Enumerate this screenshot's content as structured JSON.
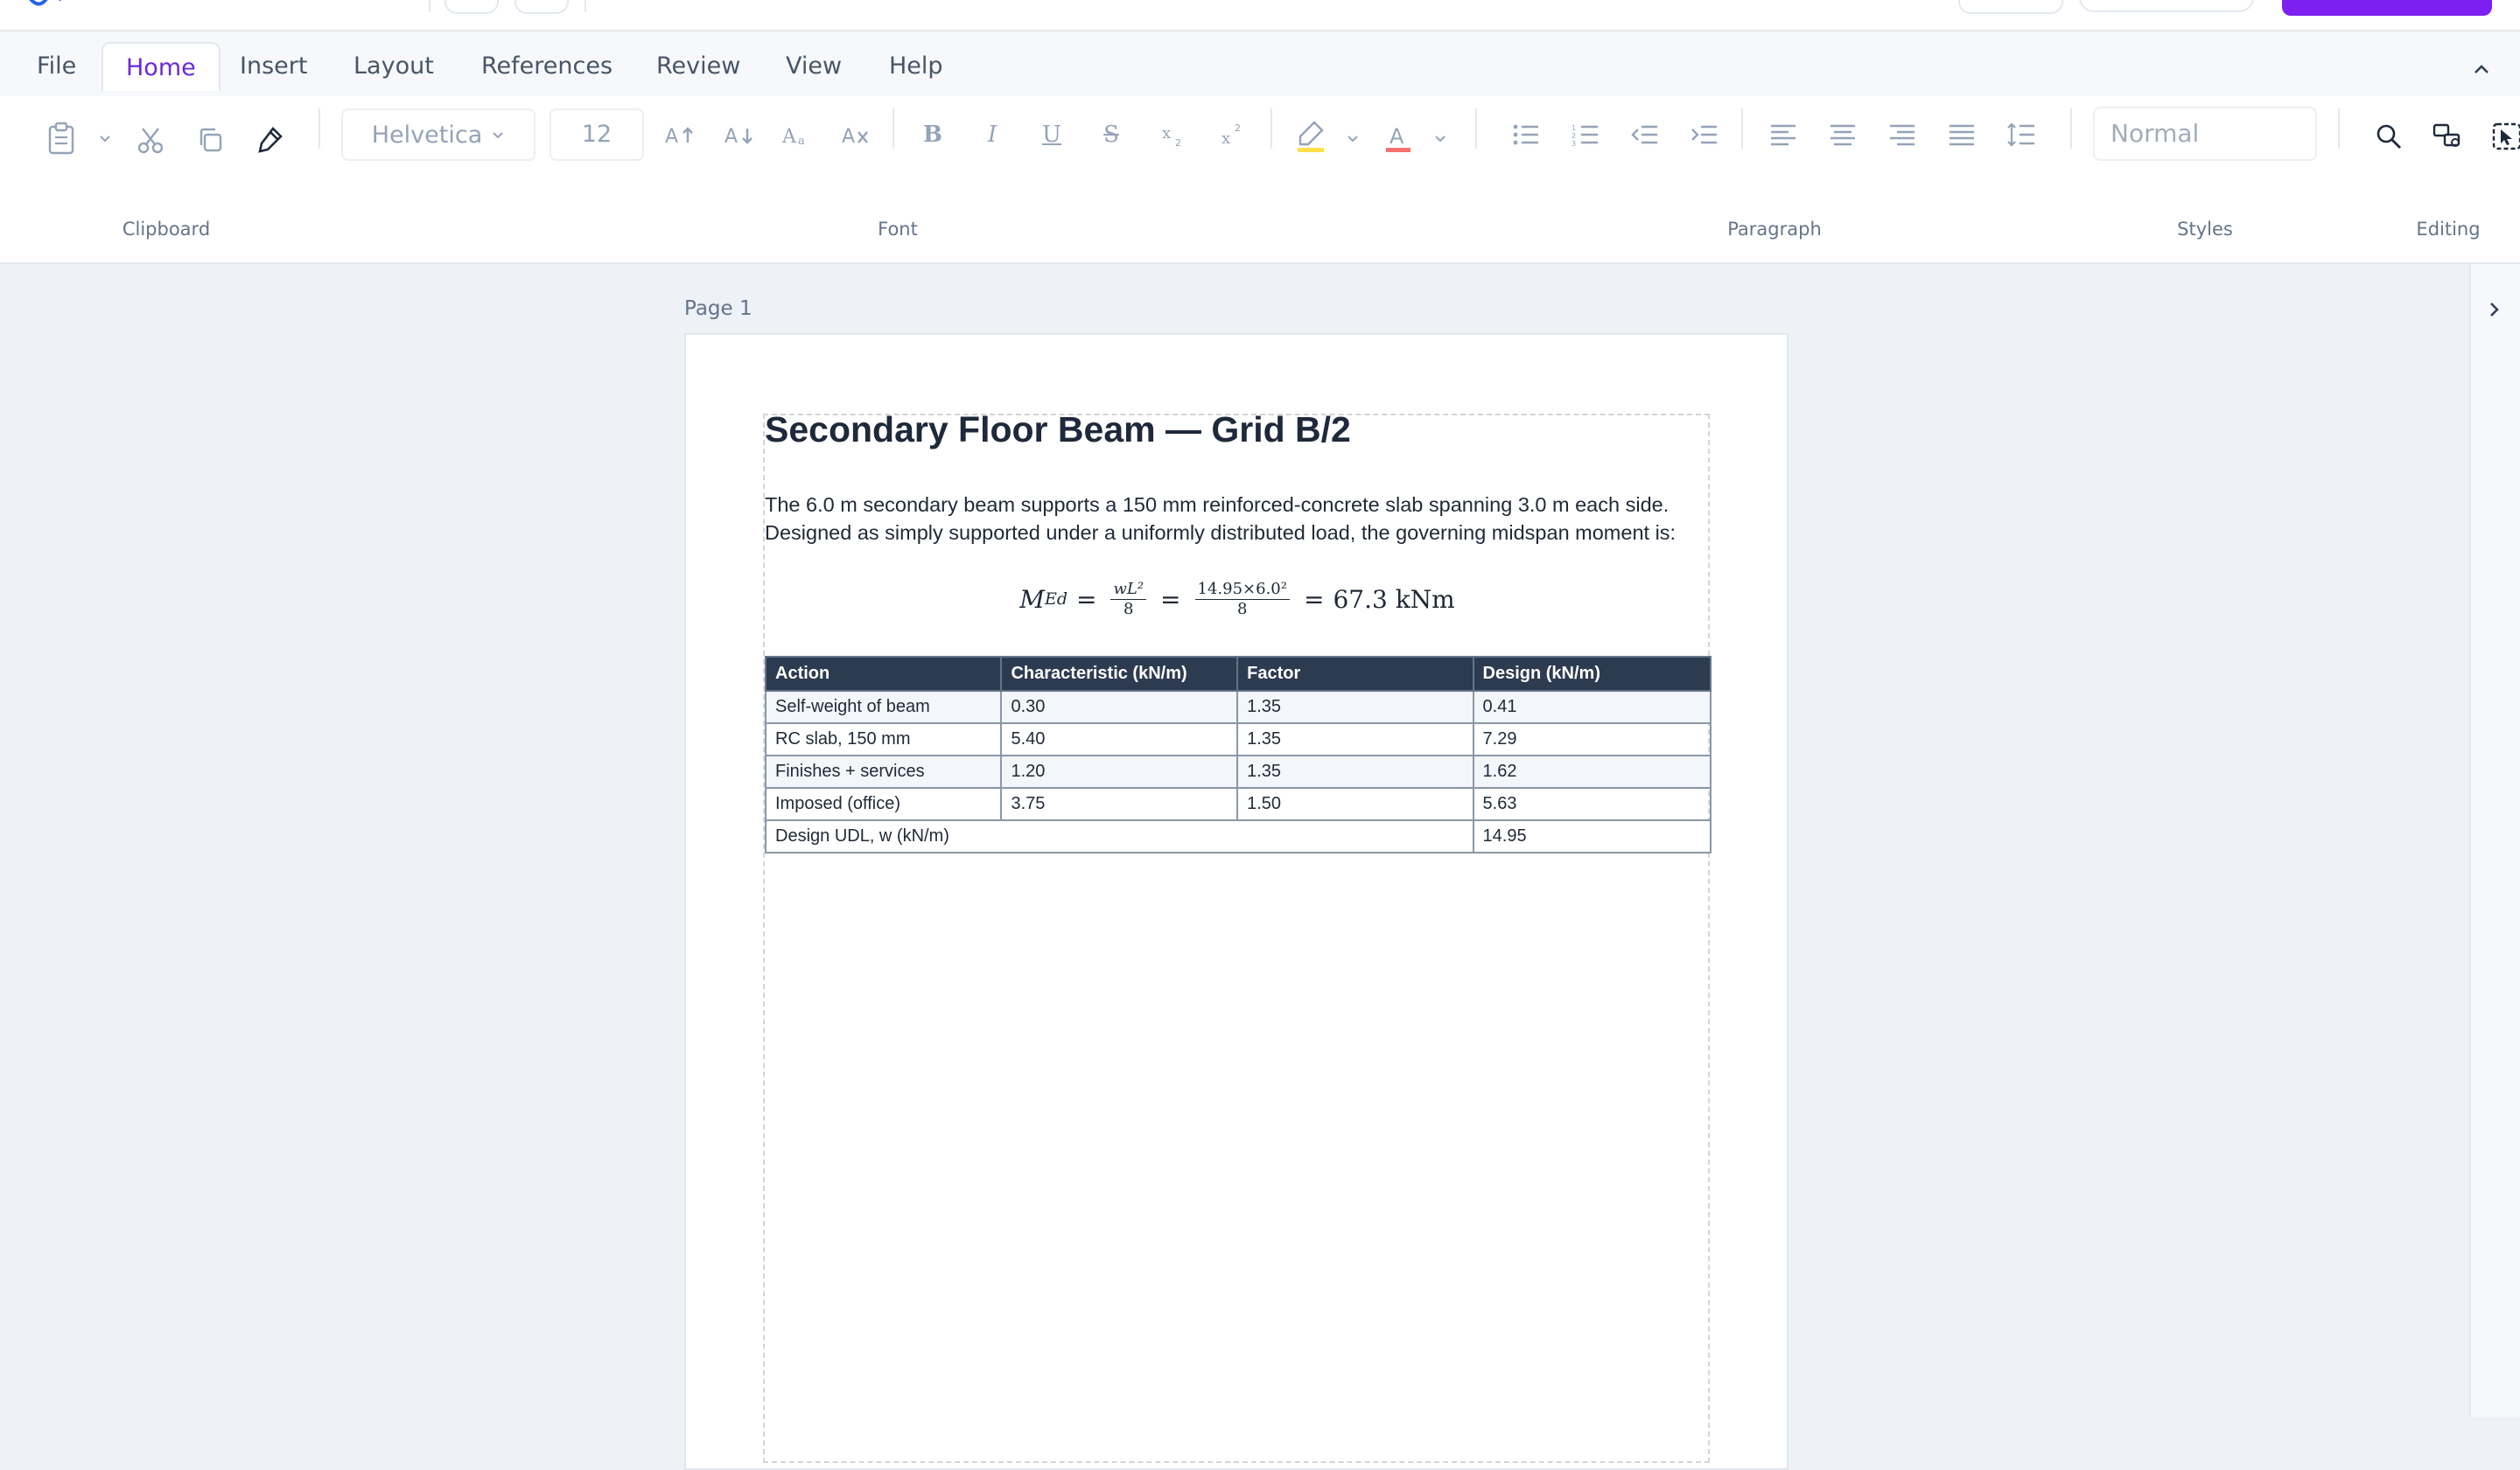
{
  "tabs": [
    "File",
    "Home",
    "Insert",
    "Layout",
    "References",
    "Review",
    "View",
    "Help"
  ],
  "active_tab": "Home",
  "ribbon": {
    "font_name": "Helvetica",
    "font_size": "12",
    "style_placeholder": "Normal",
    "groups": [
      "Clipboard",
      "Font",
      "Paragraph",
      "Styles",
      "Editing"
    ]
  },
  "page_label": "Page 1",
  "document": {
    "title": "Secondary Floor Beam — Grid B/2",
    "body": "The 6.0 m secondary beam supports a 150 mm reinforced-concrete slab spanning 3.0 m each side. Designed as simply supported under a uniformly distributed load, the governing midspan moment is:",
    "formula": {
      "lhs": "M",
      "lhs_sub": "Ed",
      "frac1_num": "wL²",
      "frac1_den": "8",
      "frac2_num": "14.95×6.0²",
      "frac2_den": "8",
      "result": "67.3 kNm"
    },
    "table": {
      "headers": [
        "Action",
        "Characteristic (kN/m)",
        "Factor",
        "Design (kN/m)"
      ],
      "rows": [
        [
          "Self-weight of beam",
          "0.30",
          "1.35",
          "0.41"
        ],
        [
          "RC slab, 150 mm",
          "5.40",
          "1.35",
          "7.29"
        ],
        [
          "Finishes + services",
          "1.20",
          "1.35",
          "1.62"
        ],
        [
          "Imposed (office)",
          "3.75",
          "1.50",
          "5.63"
        ]
      ],
      "total": [
        "Design UDL, w (kN/m)",
        "14.95"
      ]
    }
  },
  "colors": {
    "accent": "#6d28d9",
    "cta": "#7c1ff0",
    "table_header": "#2d3b50"
  }
}
